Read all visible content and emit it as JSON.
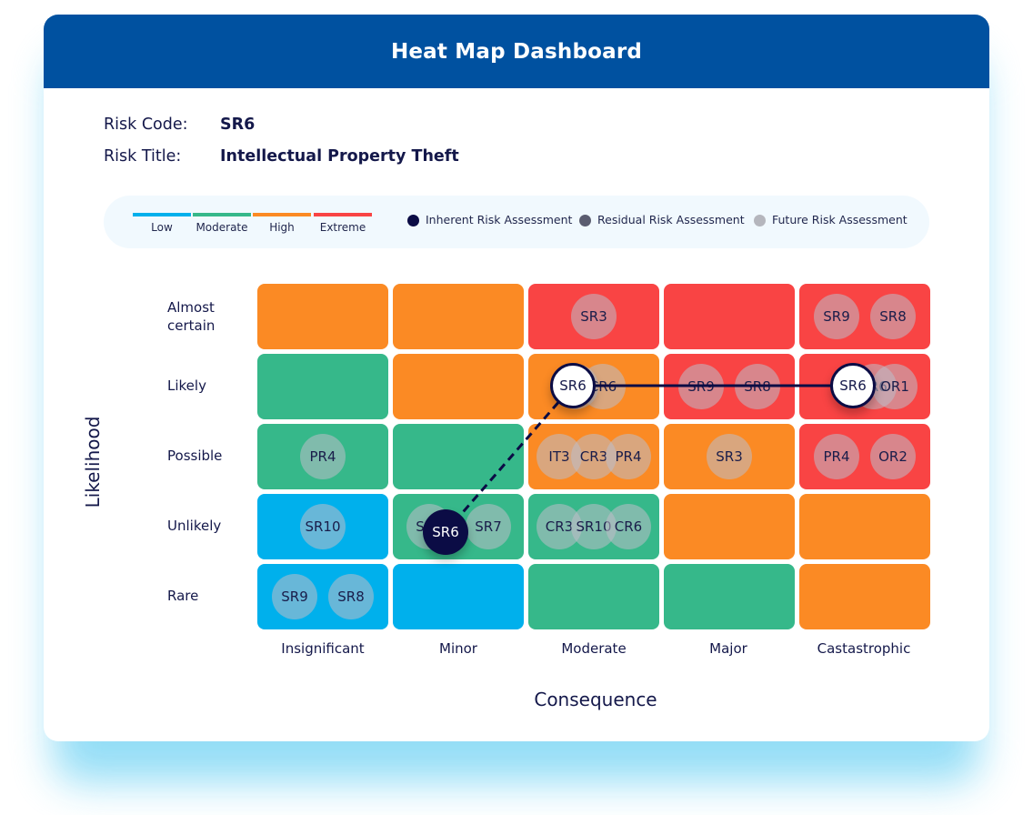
{
  "header": {
    "title": "Heat Map Dashboard"
  },
  "risk": {
    "code_label": "Risk Code:",
    "code_value": "SR6",
    "title_label": "Risk Title:",
    "title_value": "Intellectual Property Theft"
  },
  "legend": {
    "scale": [
      {
        "label": "Low",
        "color": "#00b0ec"
      },
      {
        "label": "Moderate",
        "color": "#36b88a"
      },
      {
        "label": "High",
        "color": "#fb8a24"
      },
      {
        "label": "Extreme",
        "color": "#f94444"
      }
    ],
    "assessments": [
      {
        "label": "Inherent Risk Assessment",
        "color": "#0b0c45"
      },
      {
        "label": "Residual Risk Assessment",
        "color": "#5b5d70"
      },
      {
        "label": "Future Risk Assessment",
        "color": "#b5b6bd"
      }
    ]
  },
  "chart_data": {
    "type": "heatmap",
    "title": "Heat Map Dashboard",
    "xlabel": "Consequence",
    "ylabel": "Likelihood",
    "x_categories": [
      "Insignificant",
      "Minor",
      "Moderate",
      "Major",
      "Castastrophic"
    ],
    "y_categories": [
      "Almost certain",
      "Likely",
      "Possible",
      "Unlikely",
      "Rare"
    ],
    "levels": {
      "Low": "#00b0ec",
      "Moderate": "#36b88a",
      "High": "#fb8a24",
      "Extreme": "#f94444"
    },
    "cells": [
      [
        "High",
        "High",
        "Extreme",
        "Extreme",
        "Extreme"
      ],
      [
        "Moderate",
        "High",
        "High",
        "Extreme",
        "Extreme"
      ],
      [
        "Moderate",
        "Moderate",
        "High",
        "High",
        "Extreme"
      ],
      [
        "Low",
        "Moderate",
        "Moderate",
        "High",
        "High"
      ],
      [
        "Low",
        "Low",
        "Moderate",
        "Moderate",
        "High"
      ]
    ],
    "risks_in_cells": [
      {
        "row": 0,
        "col": 2,
        "codes": [
          "SR3"
        ]
      },
      {
        "row": 0,
        "col": 4,
        "codes": [
          "SR9",
          "SR8"
        ]
      },
      {
        "row": 1,
        "col": 2,
        "codes": [
          "SR6",
          "CR6"
        ]
      },
      {
        "row": 1,
        "col": 3,
        "codes": [
          "SR9",
          "SR8"
        ]
      },
      {
        "row": 1,
        "col": 4,
        "codes": [
          "SR6",
          "OR1"
        ]
      },
      {
        "row": 2,
        "col": 0,
        "codes": [
          "PR4"
        ]
      },
      {
        "row": 2,
        "col": 2,
        "codes": [
          "IT3",
          "CR3",
          "PR4"
        ]
      },
      {
        "row": 2,
        "col": 3,
        "codes": [
          "SR3"
        ]
      },
      {
        "row": 2,
        "col": 4,
        "codes": [
          "PR4",
          "OR2"
        ]
      },
      {
        "row": 3,
        "col": 0,
        "codes": [
          "SR10"
        ]
      },
      {
        "row": 3,
        "col": 1,
        "codes": [
          "SR6",
          "SR7"
        ]
      },
      {
        "row": 3,
        "col": 2,
        "codes": [
          "CR3",
          "SR10",
          "CR6"
        ]
      },
      {
        "row": 4,
        "col": 0,
        "codes": [
          "SR9",
          "SR8"
        ]
      }
    ],
    "selected_risk": {
      "code": "SR6",
      "inherent": {
        "likelihood": "Unlikely",
        "consequence": "Minor"
      },
      "residual": {
        "likelihood": "Likely",
        "consequence": "Moderate"
      },
      "future": {
        "likelihood": "Likely",
        "consequence": "Castastrophic"
      }
    }
  }
}
